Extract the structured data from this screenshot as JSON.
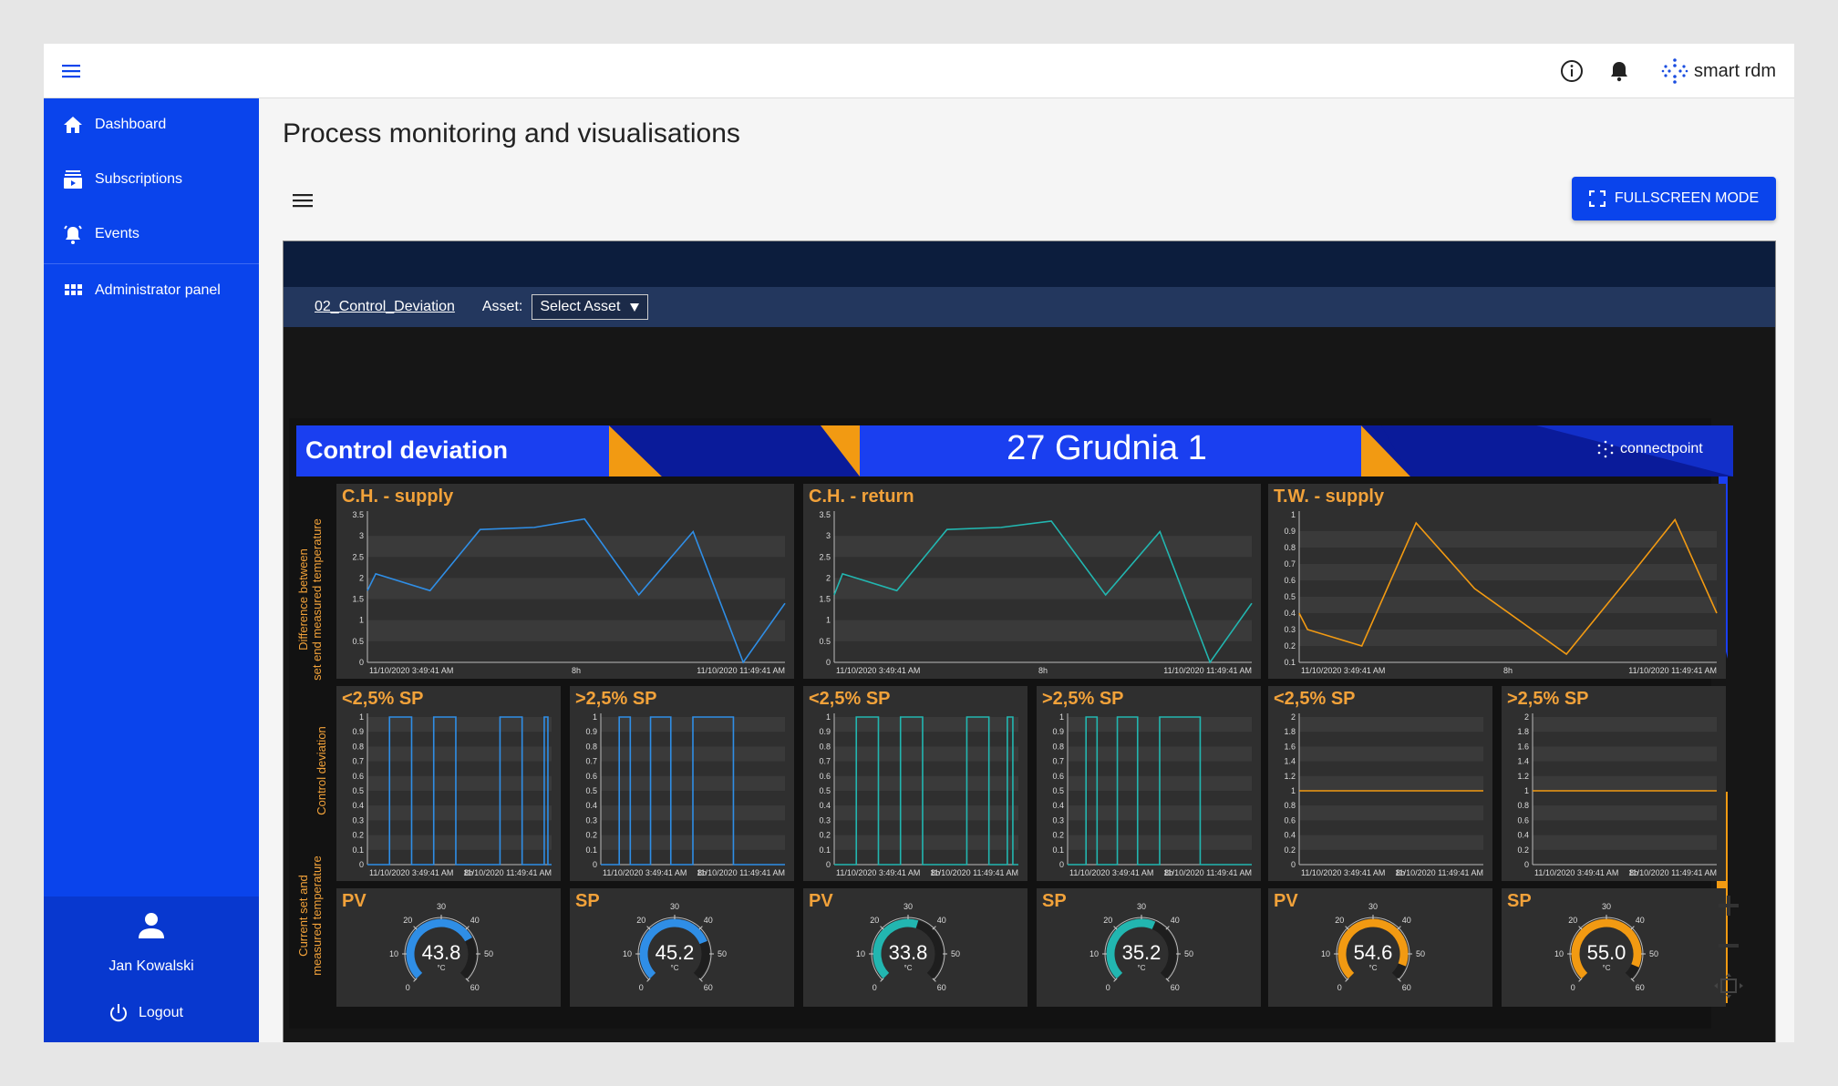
{
  "topbar": {
    "brand_name": "smart rdm"
  },
  "sidebar": {
    "items": [
      {
        "label": "Dashboard"
      },
      {
        "label": "Subscriptions"
      },
      {
        "label": "Events"
      },
      {
        "label": "Administrator panel"
      }
    ],
    "user_name": "Jan Kowalski",
    "logout_label": "Logout"
  },
  "page": {
    "title": "Process monitoring and visualisations",
    "fullscreen_label": "FULLSCREEN MODE"
  },
  "dashboard": {
    "link": "02_Control_Deviation",
    "asset_label": "Asset:",
    "asset_value": "Select Asset",
    "banner_title": "Control deviation",
    "banner_location": "27 Grudnia 1",
    "banner_logo": "connectpoint",
    "row_labels": [
      "Difference between|set end measured temperature",
      "Control deviation",
      "Current set and|measured temperature"
    ],
    "colors": {
      "blue": "#2f8ee6",
      "teal": "#22b6b0",
      "orange": "#f29a12",
      "title": "#f2a23a"
    }
  },
  "chart_data": [
    {
      "type": "line",
      "title": "C.H. - supply",
      "color": "#2f8ee6",
      "ylim": [
        0,
        3.5
      ],
      "yticks": [
        "0",
        "0.5",
        "1",
        "1.5",
        "2",
        "2.5",
        "3",
        "3.5"
      ],
      "xticks": [
        "11/10/2020 3:49:41 AM",
        "8h",
        "11/10/2020 11:49:41 AM"
      ],
      "x": [
        0,
        0.02,
        0.15,
        0.27,
        0.4,
        0.52,
        0.65,
        0.78,
        0.9,
        1
      ],
      "values": [
        1.7,
        2.1,
        1.7,
        3.15,
        3.2,
        3.4,
        1.6,
        3.1,
        0,
        1.4
      ]
    },
    {
      "type": "line",
      "title": "C.H. - return",
      "color": "#22b6b0",
      "ylim": [
        0,
        3.5
      ],
      "yticks": [
        "0",
        "0.5",
        "1",
        "1.5",
        "2",
        "2.5",
        "3",
        "3.5"
      ],
      "xticks": [
        "11/10/2020 3:49:41 AM",
        "8h",
        "11/10/2020 11:49:41 AM"
      ],
      "x": [
        0,
        0.02,
        0.15,
        0.27,
        0.4,
        0.52,
        0.65,
        0.78,
        0.9,
        1
      ],
      "values": [
        1.6,
        2.1,
        1.7,
        3.15,
        3.2,
        3.35,
        1.6,
        3.1,
        0,
        1.4
      ]
    },
    {
      "type": "line",
      "title": "T.W. - supply",
      "color": "#f29a12",
      "ylim": [
        0.1,
        1
      ],
      "yticks": [
        "0.1",
        "0.2",
        "0.3",
        "0.4",
        "0.5",
        "0.6",
        "0.7",
        "0.8",
        "0.9",
        "1"
      ],
      "xticks": [
        "11/10/2020 3:49:41 AM",
        "8h",
        "11/10/2020 11:49:41 AM"
      ],
      "x": [
        0,
        0.02,
        0.15,
        0.28,
        0.42,
        0.64,
        0.8,
        0.9,
        1
      ],
      "values": [
        0.4,
        0.3,
        0.2,
        0.95,
        0.55,
        0.15,
        0.65,
        0.97,
        0.4
      ]
    },
    {
      "type": "line",
      "title": "<2,5% SP",
      "color": "#2f8ee6",
      "ylim": [
        0,
        1
      ],
      "yticks": [
        "0",
        "0.1",
        "0.2",
        "0.3",
        "0.4",
        "0.5",
        "0.6",
        "0.7",
        "0.8",
        "0.9",
        "1"
      ],
      "xticks": [
        "11/10/2020 3:49:41 AM",
        "8h",
        "11/10/2020 11:49:41 AM"
      ],
      "pulses": [
        [
          0.12,
          0.24
        ],
        [
          0.36,
          0.48
        ],
        [
          0.72,
          0.84
        ],
        [
          0.96,
          0.98
        ]
      ]
    },
    {
      "type": "line",
      "title": ">2,5% SP",
      "color": "#2f8ee6",
      "ylim": [
        0,
        1
      ],
      "yticks": [
        "0",
        "0.1",
        "0.2",
        "0.3",
        "0.4",
        "0.5",
        "0.6",
        "0.7",
        "0.8",
        "0.9",
        "1"
      ],
      "xticks": [
        "11/10/2020 3:49:41 AM",
        "8h",
        "11/10/2020 11:49:41 AM"
      ],
      "pulses": [
        [
          0.1,
          0.16
        ],
        [
          0.27,
          0.38
        ],
        [
          0.5,
          0.72
        ]
      ]
    },
    {
      "type": "line",
      "title": "<2,5% SP",
      "color": "#22b6b0",
      "ylim": [
        0,
        1
      ],
      "yticks": [
        "0",
        "0.1",
        "0.2",
        "0.3",
        "0.4",
        "0.5",
        "0.6",
        "0.7",
        "0.8",
        "0.9",
        "1"
      ],
      "xticks": [
        "11/10/2020 3:49:41 AM",
        "8h",
        "11/10/2020 11:49:41 AM"
      ],
      "pulses": [
        [
          0.12,
          0.24
        ],
        [
          0.36,
          0.48
        ],
        [
          0.72,
          0.84
        ],
        [
          0.94,
          0.97
        ]
      ]
    },
    {
      "type": "line",
      "title": ">2,5% SP",
      "color": "#22b6b0",
      "ylim": [
        0,
        1
      ],
      "yticks": [
        "0",
        "0.1",
        "0.2",
        "0.3",
        "0.4",
        "0.5",
        "0.6",
        "0.7",
        "0.8",
        "0.9",
        "1"
      ],
      "xticks": [
        "11/10/2020 3:49:41 AM",
        "8h",
        "11/10/2020 11:49:41 AM"
      ],
      "pulses": [
        [
          0.1,
          0.16
        ],
        [
          0.27,
          0.38
        ],
        [
          0.5,
          0.72
        ]
      ]
    },
    {
      "type": "line",
      "title": "<2,5% SP",
      "color": "#f29a12",
      "ylim": [
        0,
        2
      ],
      "yticks": [
        "0",
        "0.2",
        "0.4",
        "0.6",
        "0.8",
        "1",
        "1.2",
        "1.4",
        "1.6",
        "1.8",
        "2"
      ],
      "xticks": [
        "11/10/2020 3:49:41 AM",
        "8h",
        "11/10/2020 11:49:41 AM"
      ],
      "x": [
        0,
        1
      ],
      "values": [
        1,
        1
      ]
    },
    {
      "type": "line",
      "title": ">2,5% SP",
      "color": "#f29a12",
      "ylim": [
        0,
        2
      ],
      "yticks": [
        "0",
        "0.2",
        "0.4",
        "0.6",
        "0.8",
        "1",
        "1.2",
        "1.4",
        "1.6",
        "1.8",
        "2"
      ],
      "xticks": [
        "11/10/2020 3:49:41 AM",
        "8h",
        "11/10/2020 11:49:41 AM"
      ],
      "x": [
        0,
        1
      ],
      "values": [
        1,
        1
      ]
    }
  ],
  "gauges": [
    {
      "title": "PV",
      "value": "43.8",
      "v": 43.8,
      "color": "#2f8ee6",
      "unit": "°C"
    },
    {
      "title": "SP",
      "value": "45.2",
      "v": 45.2,
      "color": "#2f8ee6",
      "unit": "°C"
    },
    {
      "title": "PV",
      "value": "33.8",
      "v": 33.8,
      "color": "#22b6b0",
      "unit": "°C"
    },
    {
      "title": "SP",
      "value": "35.2",
      "v": 35.2,
      "color": "#22b6b0",
      "unit": "°C"
    },
    {
      "title": "PV",
      "value": "54.6",
      "v": 54.6,
      "color": "#f29a12",
      "unit": "°C"
    },
    {
      "title": "SP",
      "value": "55.0",
      "v": 55.0,
      "color": "#f29a12",
      "unit": "°C"
    }
  ],
  "gauge_ticks": [
    "0",
    "10",
    "20",
    "30",
    "40",
    "50",
    "60"
  ]
}
